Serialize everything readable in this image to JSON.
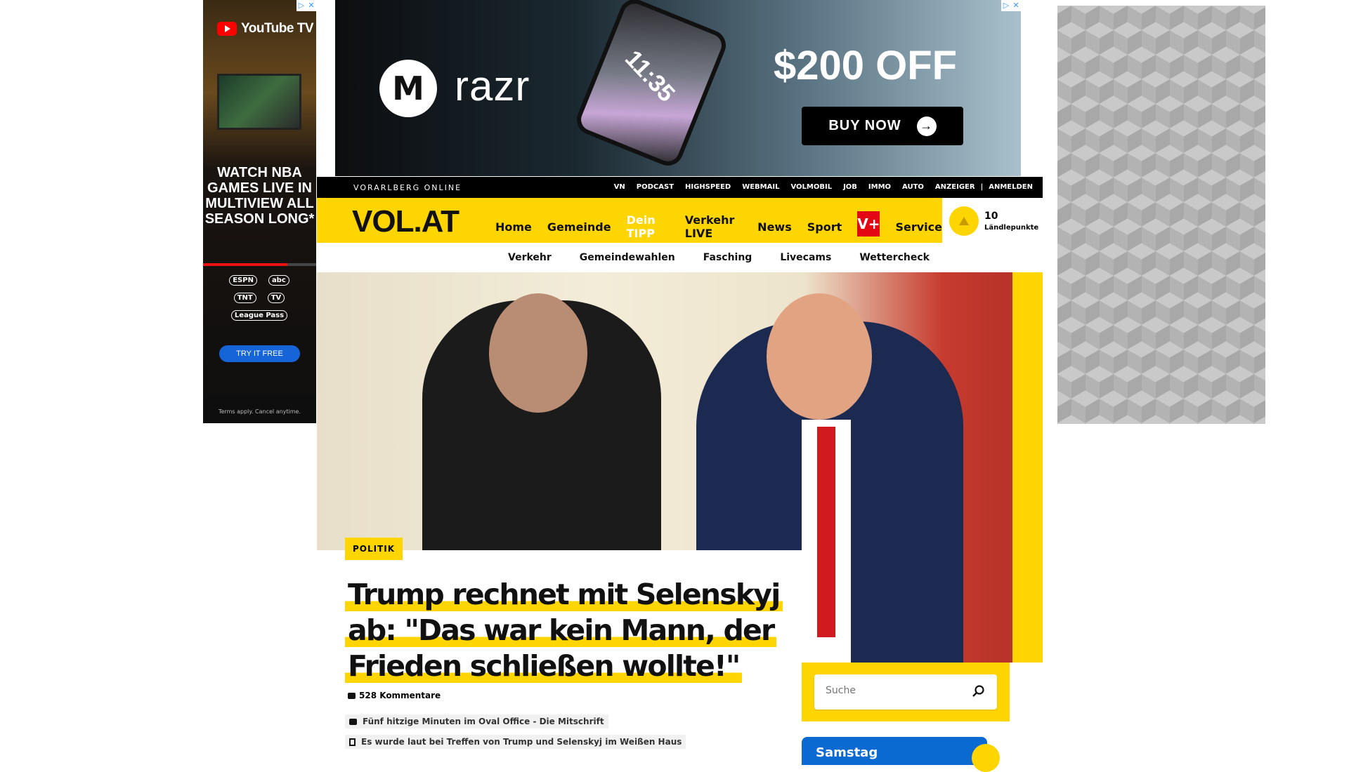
{
  "ad_left": {
    "brand": "YouTube TV",
    "headline": "WATCH NBA GAMES LIVE IN MULTIVIEW ALL SEASON LONG*",
    "logos": [
      "ESPN",
      "abc",
      "TNT",
      "TV",
      "League Pass"
    ],
    "cta": "TRY IT FREE",
    "terms": "Terms apply. Cancel anytime."
  },
  "ad_top": {
    "brand": "razr",
    "phone_time": "11:35",
    "offer": "$200 OFF",
    "cta": "BUY NOW"
  },
  "topbar": {
    "brand": "VORARLBERG ONLINE",
    "links": [
      "VN",
      "PODCAST",
      "HIGHSPEED",
      "WEBMAIL",
      "VOLMOBIL",
      "JOB",
      "IMMO",
      "AUTO",
      "ANZEIGER",
      "|",
      "ANMELDEN"
    ]
  },
  "nav": {
    "logo": "VOL.AT",
    "items": [
      "Home",
      "Gemeinde",
      "Dein TIPP",
      "Verkehr LIVE",
      "News",
      "Sport"
    ],
    "vplus": "V+",
    "service": "Service"
  },
  "points": {
    "value": "10",
    "label": "Ländlepunkte"
  },
  "subnav": {
    "items": [
      "Verkehr",
      "Gemeindewahlen",
      "Fasching",
      "Livecams",
      "Wettercheck"
    ]
  },
  "hero": {
    "category": "POLITIK",
    "title": "Trump rechnet mit Selenskyj ab: \"Das war kein Mann, der Frieden schließen wollte!\"",
    "comments": "528 Kommentare",
    "related": [
      "Fünf hitzige Minuten im Oval Office - Die Mitschrift",
      "Es wurde laut bei Treffen von Trump und Selenskyj im Weißen Haus"
    ]
  },
  "search": {
    "placeholder": "Suche"
  },
  "weather": {
    "day": "Samstag"
  },
  "colors": {
    "brand_yellow": "#ffd500",
    "vplus_red": "#e30613",
    "weather_blue": "#0a6ad2"
  }
}
